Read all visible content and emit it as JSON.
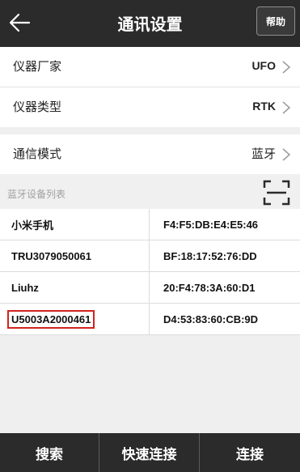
{
  "header": {
    "title": "通讯设置",
    "help_label": "帮助",
    "back_icon": "arrow-left-icon"
  },
  "settings": [
    {
      "label": "仪器厂家",
      "value": "UFO"
    },
    {
      "label": "仪器类型",
      "value": "RTK"
    },
    {
      "label": "通信模式",
      "value": "蓝牙"
    }
  ],
  "device_list": {
    "title": "蓝牙设备列表",
    "scan_icon": "scan-qr-icon",
    "devices": [
      {
        "name": "小米手机",
        "mac": "F4:F5:DB:E4:E5:46"
      },
      {
        "name": "TRU3079050061",
        "mac": "BF:18:17:52:76:DD"
      },
      {
        "name": "Liuhz",
        "mac": "20:F4:78:3A:60:D1"
      },
      {
        "name": "U5003A2000461",
        "mac": "D4:53:83:60:CB:9D"
      }
    ]
  },
  "footer": {
    "search_label": "搜索",
    "quick_connect_label": "快速连接",
    "connect_label": "连接"
  },
  "colors": {
    "bar_background": "#2b2b2b",
    "highlight_border": "#d2231f",
    "page_background": "#efefef"
  }
}
